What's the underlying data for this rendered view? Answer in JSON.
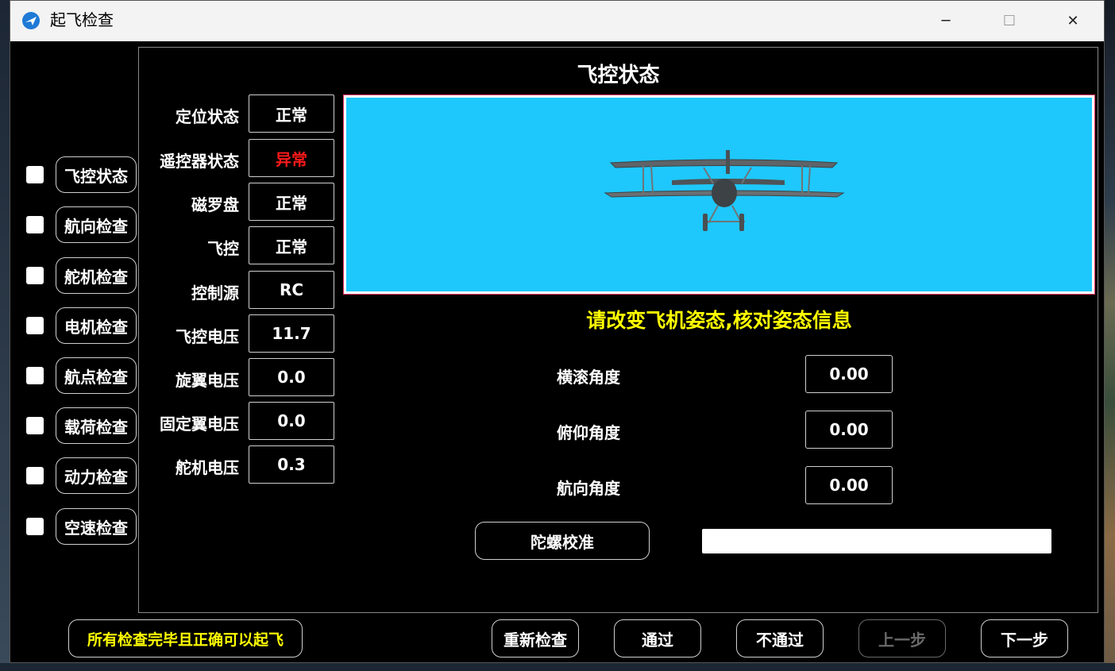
{
  "window": {
    "title": "起飞检查",
    "minimize_glyph": "─",
    "maximize_glyph": "☐",
    "close_glyph": "✕"
  },
  "sidebar": {
    "items": [
      {
        "label": "飞控状态",
        "checked": false
      },
      {
        "label": "航向检查",
        "checked": false
      },
      {
        "label": "舵机检查",
        "checked": false
      },
      {
        "label": "电机检查",
        "checked": false
      },
      {
        "label": "航点检查",
        "checked": false
      },
      {
        "label": "载荷检查",
        "checked": false
      },
      {
        "label": "动力检查",
        "checked": false
      },
      {
        "label": "空速检查",
        "checked": false
      }
    ]
  },
  "panel": {
    "title": "飞控状态",
    "status_items": [
      {
        "label": "定位状态",
        "value": "正常"
      },
      {
        "label": "遥控器状态",
        "value": "异常"
      },
      {
        "label": "磁罗盘",
        "value": "正常"
      },
      {
        "label": "飞控",
        "value": "正常"
      },
      {
        "label": "控制源",
        "value": "RC"
      },
      {
        "label": "飞控电压",
        "value": "11.7"
      },
      {
        "label": "旋翼电压",
        "value": "0.0"
      },
      {
        "label": "固定翼电压",
        "value": "0.0"
      },
      {
        "label": "舵机电压",
        "value": "0.3"
      }
    ],
    "prompt": "请改变飞机姿态,核对姿态信息",
    "attitude": [
      {
        "label": "横滚角度",
        "value": "0.00"
      },
      {
        "label": "俯仰角度",
        "value": "0.00"
      },
      {
        "label": "航向角度",
        "value": "0.00"
      }
    ],
    "gyro_button": "陀螺校准",
    "gyro_progress": 0
  },
  "footer": {
    "notice": "所有检查完毕且正确可以起飞",
    "recheck": "重新检查",
    "pass": "通过",
    "fail": "不通过",
    "prev": "上一步",
    "next": "下一步"
  },
  "colors": {
    "sky": "#1ec8fc",
    "alert": "#ff1a1a",
    "prompt": "#ffff00"
  }
}
